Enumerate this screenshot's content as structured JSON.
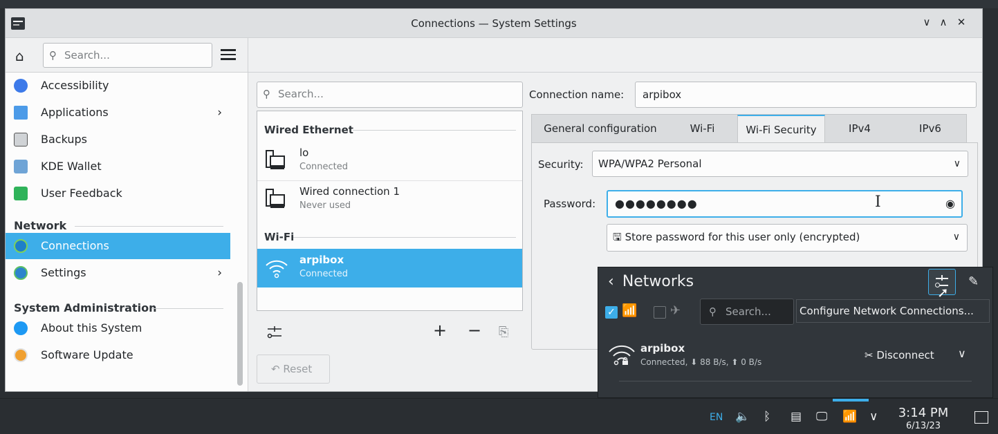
{
  "window": {
    "title": "Connections — System Settings"
  },
  "toolbar": {
    "search_placeholder": "Search..."
  },
  "sidebar": {
    "items": [
      {
        "label": "Accessibility",
        "icon": "accessibility-icon"
      },
      {
        "label": "Applications",
        "icon": "applications-icon",
        "has_submenu": true
      },
      {
        "label": "Backups",
        "icon": "backups-icon"
      },
      {
        "label": "KDE Wallet",
        "icon": "kde-wallet-icon"
      },
      {
        "label": "User Feedback",
        "icon": "user-feedback-icon"
      }
    ],
    "network_header": "Network",
    "network_items": [
      {
        "label": "Connections",
        "icon": "connections-icon",
        "active": true
      },
      {
        "label": "Settings",
        "icon": "settings-icon",
        "has_submenu": true
      }
    ],
    "sysadmin_header": "System Administration",
    "sysadmin_items": [
      {
        "label": "About this System",
        "icon": "info-icon"
      },
      {
        "label": "Software Update",
        "icon": "software-update-icon"
      }
    ]
  },
  "connections": {
    "search_placeholder": "Search...",
    "wired_header": "Wired Ethernet",
    "wired": [
      {
        "name": "lo",
        "status": "Connected"
      },
      {
        "name": "Wired connection 1",
        "status": "Never used"
      }
    ],
    "wifi_header": "Wi-Fi",
    "wifi": [
      {
        "name": "arpibox",
        "status": "Connected",
        "selected": true
      }
    ],
    "reset_label": "Reset"
  },
  "details": {
    "connection_name_label": "Connection name:",
    "connection_name": "arpibox",
    "tabs": [
      "General configuration",
      "Wi-Fi",
      "Wi-Fi Security",
      "IPv4",
      "IPv6"
    ],
    "active_tab": "Wi-Fi Security",
    "security_label": "Security:",
    "security_value": "WPA/WPA2 Personal",
    "password_label": "Password:",
    "password_value": "●●●●●●●●",
    "store_password": "Store password for this user only (encrypted)"
  },
  "networks_popup": {
    "title": "Networks",
    "search_placeholder": "Search...",
    "tooltip": "Configure Network Connections...",
    "wifi_enabled": true,
    "airplane_mode": false,
    "network": {
      "name": "arpibox",
      "status": "Connected, ⬇ 88 B/s, ⬆ 0 B/s",
      "action": "Disconnect"
    }
  },
  "taskbar": {
    "keyboard_layout": "EN",
    "time": "3:14 PM",
    "date": "6/13/23"
  },
  "colors": {
    "accent": "#3daee9",
    "panel": "#31363b"
  }
}
